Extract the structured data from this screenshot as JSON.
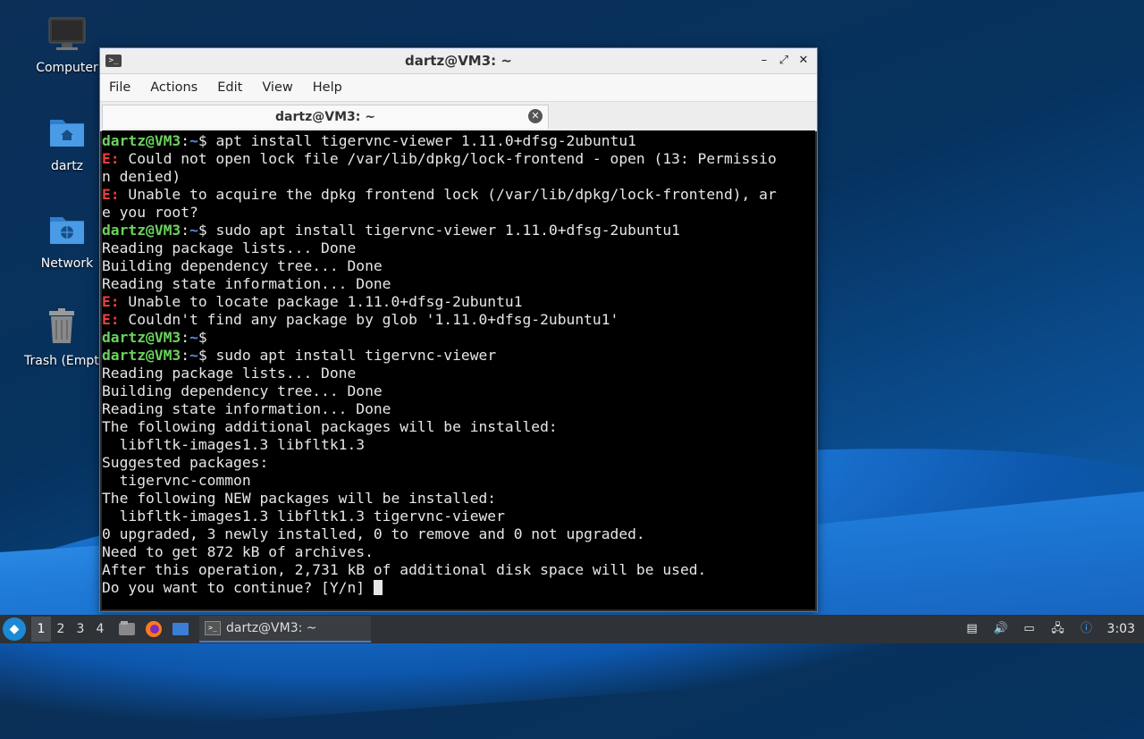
{
  "desktop": {
    "icons": [
      {
        "label": "Computer"
      },
      {
        "label": "dartz"
      },
      {
        "label": "Network"
      },
      {
        "label": "Trash (Empty)"
      }
    ]
  },
  "window": {
    "title": "dartz@VM3: ~",
    "menu": [
      "File",
      "Actions",
      "Edit",
      "View",
      "Help"
    ],
    "tab_label": "dartz@VM3: ~",
    "controls": {
      "minimize": "–",
      "maximize": "⤢",
      "close": "✕"
    }
  },
  "terminal": {
    "lines": [
      {
        "user": "dartz@VM3",
        "path": "~",
        "cmd": "$ apt install tigervnc-viewer 1.11.0+dfsg-2ubuntu1"
      },
      {
        "err": "E:",
        "text": " Could not open lock file /var/lib/dpkg/lock-frontend - open (13: Permissio"
      },
      {
        "text": "n denied)"
      },
      {
        "err": "E:",
        "text": " Unable to acquire the dpkg frontend lock (/var/lib/dpkg/lock-frontend), ar"
      },
      {
        "text": "e you root?"
      },
      {
        "user": "dartz@VM3",
        "path": "~",
        "cmd": "$ sudo apt install tigervnc-viewer 1.11.0+dfsg-2ubuntu1"
      },
      {
        "text": "Reading package lists... Done"
      },
      {
        "text": "Building dependency tree... Done"
      },
      {
        "text": "Reading state information... Done"
      },
      {
        "err": "E:",
        "text": " Unable to locate package 1.11.0+dfsg-2ubuntu1"
      },
      {
        "err": "E:",
        "text": " Couldn't find any package by glob '1.11.0+dfsg-2ubuntu1'"
      },
      {
        "user": "dartz@VM3",
        "path": "~",
        "cmd": "$"
      },
      {
        "user": "dartz@VM3",
        "path": "~",
        "cmd": "$ sudo apt install tigervnc-viewer"
      },
      {
        "text": "Reading package lists... Done"
      },
      {
        "text": "Building dependency tree... Done"
      },
      {
        "text": "Reading state information... Done"
      },
      {
        "text": "The following additional packages will be installed:"
      },
      {
        "text": "  libfltk-images1.3 libfltk1.3"
      },
      {
        "text": "Suggested packages:"
      },
      {
        "text": "  tigervnc-common"
      },
      {
        "text": "The following NEW packages will be installed:"
      },
      {
        "text": "  libfltk-images1.3 libfltk1.3 tigervnc-viewer"
      },
      {
        "text": "0 upgraded, 3 newly installed, 0 to remove and 0 not upgraded."
      },
      {
        "text": "Need to get 872 kB of archives."
      },
      {
        "text": "After this operation, 2,731 kB of additional disk space will be used."
      },
      {
        "text": "Do you want to continue? [Y/n] ",
        "cursor": true
      }
    ]
  },
  "taskbar": {
    "workspaces": [
      "1",
      "2",
      "3",
      "4"
    ],
    "active_workspace": "1",
    "task_label": "dartz@VM3: ~",
    "clock": "3:03"
  },
  "colors": {
    "prompt_user": "#6bd25d",
    "prompt_path": "#5b8de0",
    "error": "#ef3d3d",
    "accent": "#3b7ed6"
  }
}
